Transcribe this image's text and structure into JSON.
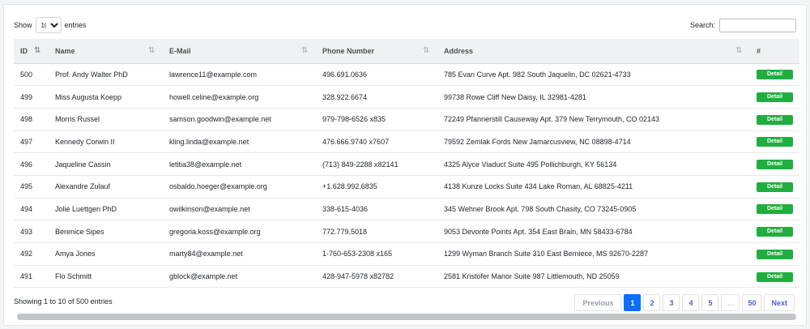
{
  "length_menu": {
    "before": "Show",
    "value": "10",
    "after": "entries"
  },
  "search": {
    "label": "Search:",
    "value": ""
  },
  "columns": [
    {
      "label": "ID"
    },
    {
      "label": "Name"
    },
    {
      "label": "E-Mail"
    },
    {
      "label": "Phone Number"
    },
    {
      "label": "Address"
    },
    {
      "label": "#"
    }
  ],
  "rows": [
    {
      "id": "500",
      "name": "Prof. Andy Walter PhD",
      "email": "lawrence11@example.com",
      "phone": "496.691.0636",
      "address": "785 Evan Curve Apt. 982 South Jaquelin, DC 02621-4733",
      "action": "Detail"
    },
    {
      "id": "499",
      "name": "Miss Augusta Koepp",
      "email": "howell.celine@example.org",
      "phone": "328.922.6674",
      "address": "99738 Rowe Cliff New Daisy, IL 32981-4281",
      "action": "Detail"
    },
    {
      "id": "498",
      "name": "Morris Russel",
      "email": "samson.goodwin@example.net",
      "phone": "979-798-6526 x835",
      "address": "72249 Pfannerstill Causeway Apt. 379 New Terrymouth, CO 02143",
      "action": "Detail"
    },
    {
      "id": "497",
      "name": "Kennedy Corwin II",
      "email": "kling.linda@example.net",
      "phone": "476.666.9740 x7607",
      "address": "79592 Zemlak Fords New Jamarcusview, NC 08898-4714",
      "action": "Detail"
    },
    {
      "id": "496",
      "name": "Jaqueline Cassin",
      "email": "letitia38@example.net",
      "phone": "(713) 849-2288 x82141",
      "address": "4325 Alyce Viaduct Suite 495 Pollichburgh, KY 56134",
      "action": "Detail"
    },
    {
      "id": "495",
      "name": "Alexandre Zulauf",
      "email": "osbaldo.hoeger@example.org",
      "phone": "+1.628.992.6835",
      "address": "4138 Kunze Locks Suite 434 Lake Roman, AL 68825-4211",
      "action": "Detail"
    },
    {
      "id": "494",
      "name": "Jolie Luettgen PhD",
      "email": "owilkinson@example.net",
      "phone": "338-615-4036",
      "address": "345 Wehner Brook Apt. 798 South Chasity, CO 73245-0905",
      "action": "Detail"
    },
    {
      "id": "493",
      "name": "Berenice Sipes",
      "email": "gregoria.koss@example.org",
      "phone": "772.779.5018",
      "address": "9053 Devonte Points Apt. 354 East Brain, MN 58433-6784",
      "action": "Detail"
    },
    {
      "id": "492",
      "name": "Amya Jones",
      "email": "marty84@example.net",
      "phone": "1-760-653-2308 x165",
      "address": "1299 Wyman Branch Suite 310 East Berniece, MS 92670-2287",
      "action": "Detail"
    },
    {
      "id": "491",
      "name": "Flo Schmitt",
      "email": "gblock@example.net",
      "phone": "428-947-5978 x82782",
      "address": "2581 Kristofer Manor Suite 987 Littlemouth, ND 25059",
      "action": "Detail"
    }
  ],
  "info": "Showing 1 to 10 of 500 entries",
  "pagination": {
    "previous": "Previous",
    "pages": [
      "1",
      "2",
      "3",
      "4",
      "5"
    ],
    "ellipsis": "…",
    "last": "50",
    "next": "Next"
  },
  "colors": {
    "accent": "#0d6efd",
    "detail_button": "#1fae3f",
    "link": "#4a62d8"
  }
}
